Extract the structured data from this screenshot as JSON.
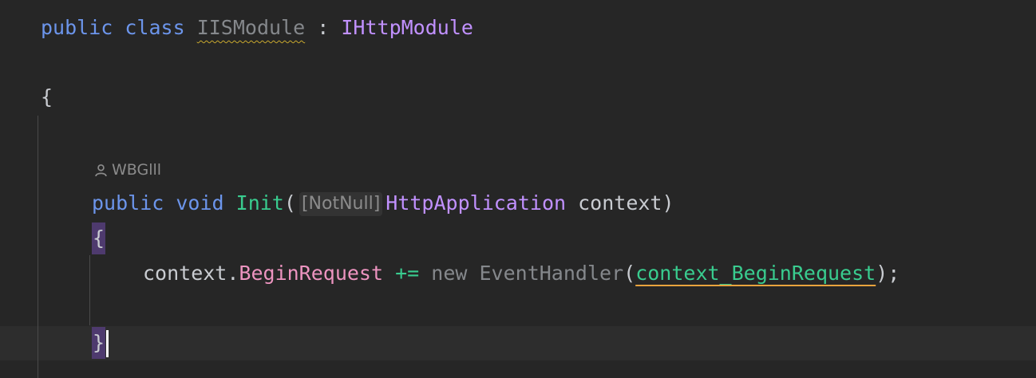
{
  "code": {
    "line1": {
      "kw_public": "public",
      "kw_class": "class",
      "class_name": "IISModule",
      "colon": ":",
      "interface": "IHttpModule"
    },
    "line2": {
      "brace": "{"
    },
    "codevision": {
      "icon": "user-icon",
      "author": "WBGlll"
    },
    "line3": {
      "kw_public": "public",
      "kw_void": "void",
      "method": "Init",
      "paren_open": "(",
      "hint": "[NotNull]",
      "param_type": "HttpApplication",
      "param_name": "context",
      "paren_close": ")"
    },
    "line4": {
      "brace": "{"
    },
    "line5": {
      "target": "context",
      "dot": ".",
      "event": "BeginRequest",
      "op": "+=",
      "kw_new": "new",
      "handler_type": "EventHandler",
      "paren_open": "(",
      "handler": "context_BeginRequest",
      "end": ");"
    },
    "line6": {
      "brace": "}"
    }
  },
  "colors": {
    "background": "#262626",
    "keyword": "#6c95eb",
    "interface": "#c191ff",
    "method": "#39cc8f",
    "event": "#ed94c0",
    "brace_highlight": "#4e3a6e"
  }
}
